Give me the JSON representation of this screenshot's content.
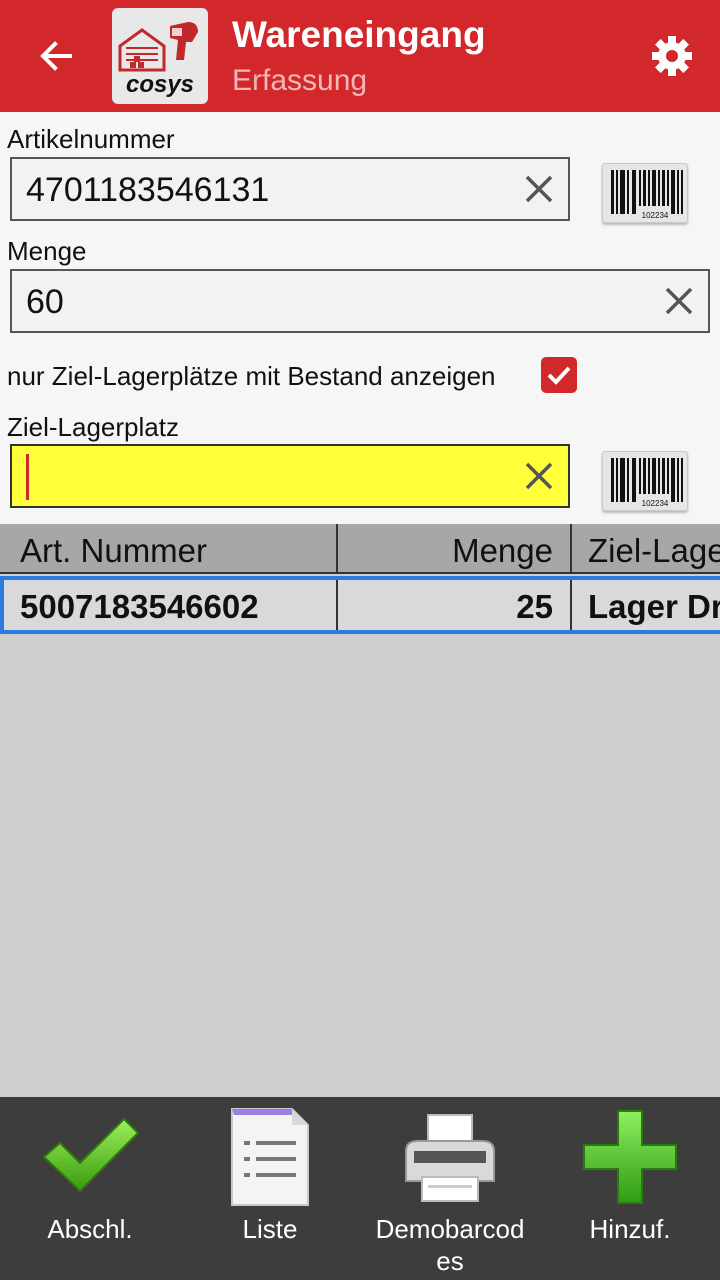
{
  "header": {
    "title": "Wareneingang",
    "subtitle": "Erfassung",
    "logo_text": "cosys",
    "back_icon": "arrow-left-icon",
    "settings_icon": "gear-icon",
    "bar_color": "#d2282b"
  },
  "form": {
    "article_label": "Artikelnummer",
    "article_value": "4701183546131",
    "quantity_label": "Menge",
    "quantity_value": "60",
    "filter_label": "nur Ziel-Lagerplätze mit Bestand anzeigen",
    "filter_checked": true,
    "target_label": "Ziel-Lagerplatz",
    "target_value": "",
    "barcode_icon_caption": "102234",
    "active_field_color": "#ffff3a"
  },
  "table": {
    "columns": [
      "Art. Nummer",
      "Menge",
      "Ziel-Lage"
    ],
    "rows": [
      [
        "5007183546602",
        "25",
        "Lager Dr"
      ]
    ],
    "selected_row": 0,
    "selection_color": "#2b7be3"
  },
  "bottom_bar": {
    "items": [
      {
        "label": "Abschl.",
        "icon": "green-checkmark-icon"
      },
      {
        "label": "Liste",
        "icon": "list-document-icon"
      },
      {
        "label": "Demobarcodes",
        "icon": "printer-icon"
      },
      {
        "label": "Hinzuf.",
        "icon": "green-plus-icon"
      }
    ]
  }
}
